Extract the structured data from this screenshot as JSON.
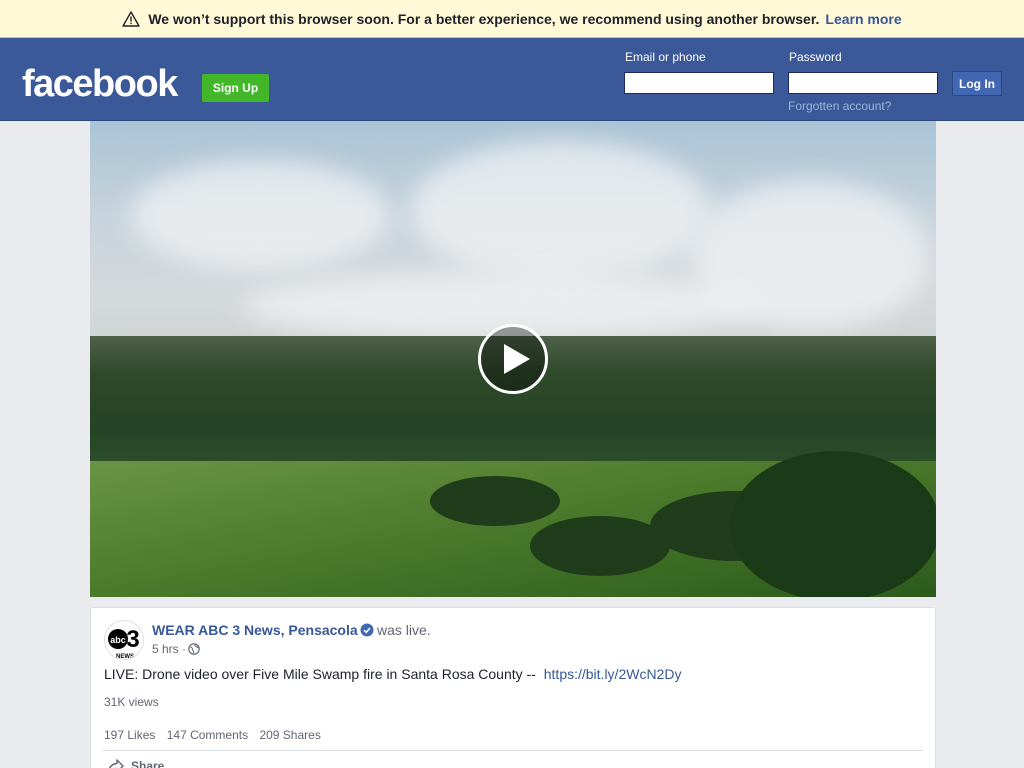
{
  "banner": {
    "icon": "warning-icon",
    "message": "We won’t support this browser soon. For a better experience, we recommend using another browser.",
    "link_label": "Learn more"
  },
  "header": {
    "logo": "facebook",
    "signup_label": "Sign Up",
    "email_label": "Email or phone",
    "email_value": "",
    "password_label": "Password",
    "password_value": "",
    "forgot_label": "Forgotten account?",
    "login_label": "Log In",
    "colors": {
      "bar": "#3b5998",
      "signup": "#42b72a"
    }
  },
  "video": {
    "play_icon": "play-icon"
  },
  "post": {
    "page_name": "WEAR ABC 3 News, Pensacola",
    "verified_icon": "verified-badge-icon",
    "status": "was live.",
    "time": "5 hrs ·",
    "privacy_icon": "globe-icon",
    "text": "LIVE: Drone video over Five Mile Swamp fire in Santa Rosa County --",
    "link": "https://bit.ly/2WcN2Dy",
    "views": "31K views",
    "likes": "197 Likes",
    "comments": "147 Comments",
    "shares": "209 Shares",
    "share_label": "Share",
    "avatar_text": "abc3",
    "avatar_sub": "NEWS"
  }
}
